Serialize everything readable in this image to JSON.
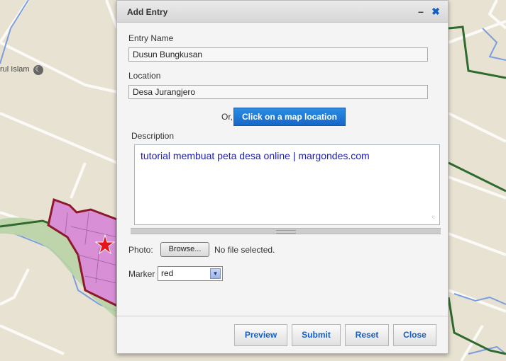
{
  "map": {
    "place_label": "rul Islam",
    "mosque_icon": "crescent-icon"
  },
  "dialog": {
    "title": "Add Entry",
    "minimize_icon": "minimize-icon",
    "close_icon": "close-icon",
    "minimize_glyph": "–",
    "close_glyph": "✖",
    "entry_name_label": "Entry Name",
    "entry_name_value": "Dusun Bungkusan",
    "location_label": "Location",
    "location_value": "Desa Jurangjero",
    "or_label": "Or,",
    "map_location_button": "Click on a map location",
    "description_label": "Description",
    "description_value": "tutorial membuat peta desa online | margondes.com",
    "photo_label": "Photo:",
    "browse_button": "Browse...",
    "file_status": "No file selected.",
    "marker_label": "Marker",
    "marker_value": "red",
    "buttons": {
      "preview": "Preview",
      "submit": "Submit",
      "reset": "Reset",
      "close": "Close"
    }
  },
  "colors": {
    "accent_blue": "#1560c8",
    "button_blue": "#1e78d8",
    "polygon_fill": "#d98fd6",
    "polygon_stroke": "#8b1a2a",
    "marker_red": "#e8141c"
  }
}
